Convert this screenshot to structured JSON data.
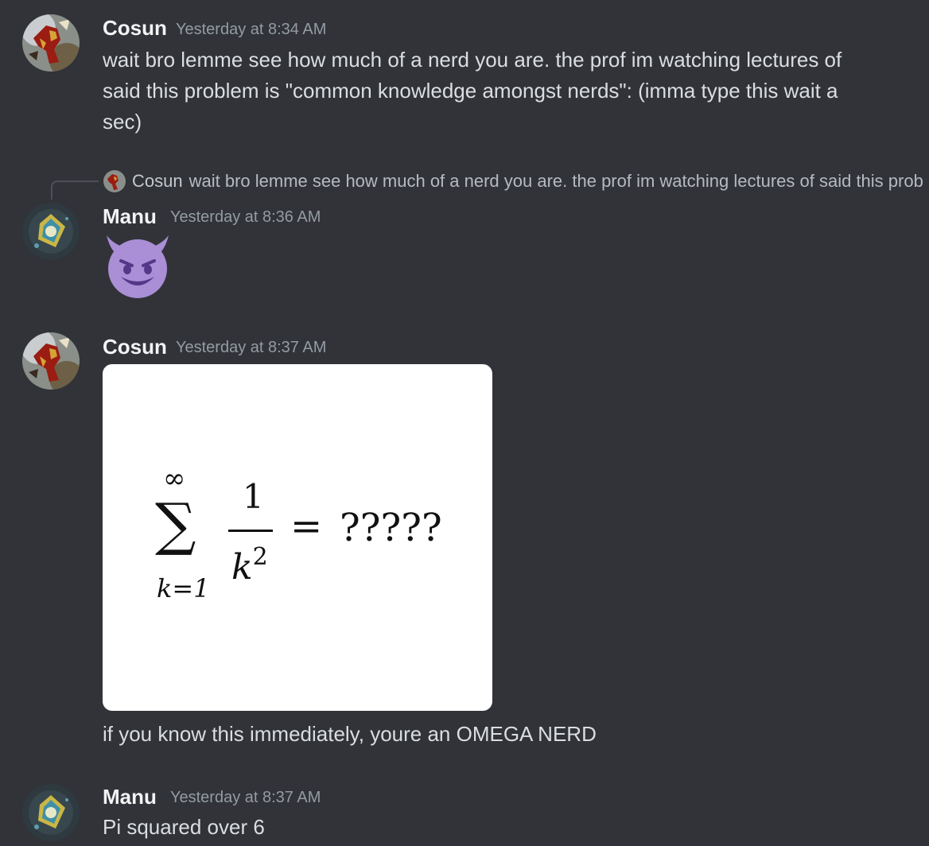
{
  "messages": [
    {
      "author": "Cosun",
      "timestamp": "Yesterday at 8:34 AM",
      "text_lines": [
        "wait bro lemme see how much of a nerd you are. the prof im watching lectures of",
        "said this problem is \"common knowledge amongst nerds\": (imma type this wait a",
        "sec)"
      ]
    },
    {
      "author": "Manu",
      "timestamp": "Yesterday at 8:36 AM",
      "reply": {
        "author": "Cosun",
        "text": "wait bro lemme see how much of a nerd you are. the prof im watching lectures of said this problem is \"common knowledge amongst nerds\": (imma type this wait a sec)"
      },
      "emoji": "smiling-face-with-horns"
    },
    {
      "author": "Cosun",
      "timestamp": "Yesterday at 8:37 AM",
      "image": {
        "sum_upper": "∞",
        "sigma": "∑",
        "sum_lower": "k=1",
        "numerator": "1",
        "denominator_base": "k",
        "denominator_exp": "2",
        "equals": "=",
        "result": "?????"
      },
      "text": "if you know this immediately, youre an OMEGA NERD"
    },
    {
      "author": "Manu",
      "timestamp": "Yesterday at 8:37 AM",
      "text": "Pi squared over 6"
    }
  ],
  "colors": {
    "background": "#313338",
    "username": "#f2f3f5",
    "timestamp": "#949ba4",
    "message_text": "#dbdee1",
    "emoji_purple": "#aa8ed6"
  }
}
